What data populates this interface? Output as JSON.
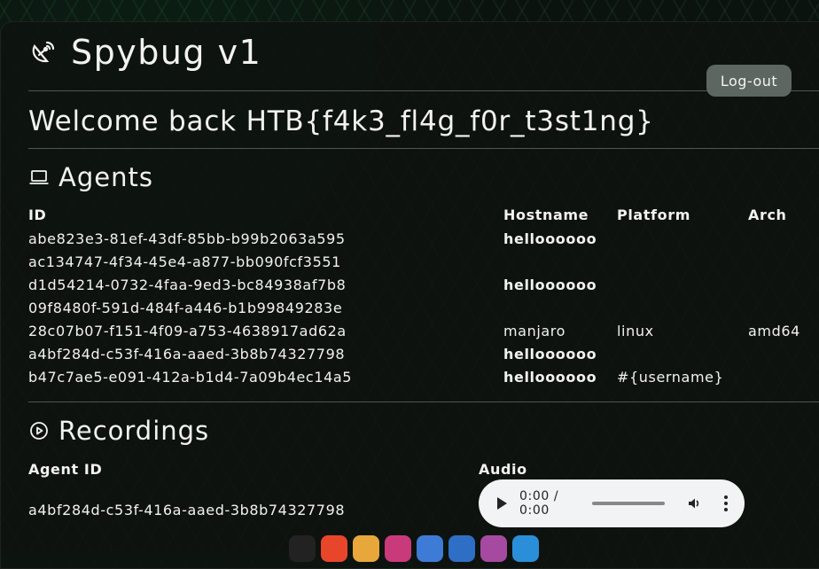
{
  "app": {
    "title": "Spybug v1",
    "logout_label": "Log-out"
  },
  "welcome": "Welcome back HTB{f4k3_fl4g_f0r_t3st1ng}",
  "agents": {
    "title": "Agents",
    "columns": [
      "ID",
      "Hostname",
      "Platform",
      "Arch"
    ],
    "rows": [
      {
        "id": "abe823e3-81ef-43df-85bb-b99b2063a595",
        "hostname": "helloooooo",
        "platform": "",
        "arch": ""
      },
      {
        "id": "ac134747-4f34-45e4-a877-bb090fcf3551",
        "hostname": "",
        "platform": "",
        "arch": ""
      },
      {
        "id": "d1d54214-0732-4faa-9ed3-bc84938af7b8",
        "hostname": "helloooooo",
        "platform": "",
        "arch": ""
      },
      {
        "id": "09f8480f-591d-484f-a446-b1b99849283e",
        "hostname": "",
        "platform": "",
        "arch": ""
      },
      {
        "id": "28c07b07-f151-4f09-a753-4638917ad62a",
        "hostname": "manjaro",
        "platform": "linux",
        "arch": "amd64"
      },
      {
        "id": "a4bf284d-c53f-416a-aaed-3b8b74327798",
        "hostname": "helloooooo",
        "platform": "",
        "arch": ""
      },
      {
        "id": "b47c7ae5-e091-412a-b1d4-7a09b4ec14a5",
        "hostname": "helloooooo",
        "platform": "#{username}",
        "arch": ""
      }
    ]
  },
  "recordings": {
    "title": "Recordings",
    "columns": [
      "Agent ID",
      "Audio"
    ],
    "rows": [
      {
        "agent_id": "a4bf284d-c53f-416a-aaed-3b8b74327798",
        "time": "0:00 / 0:00"
      }
    ]
  },
  "colors": {
    "background": "#0b130e",
    "button": "#5d6660",
    "divider": "#4f5651"
  },
  "icons": {
    "brand": "satellite-dish-icon",
    "agents": "laptop-icon",
    "recordings": "play-circle-icon"
  }
}
